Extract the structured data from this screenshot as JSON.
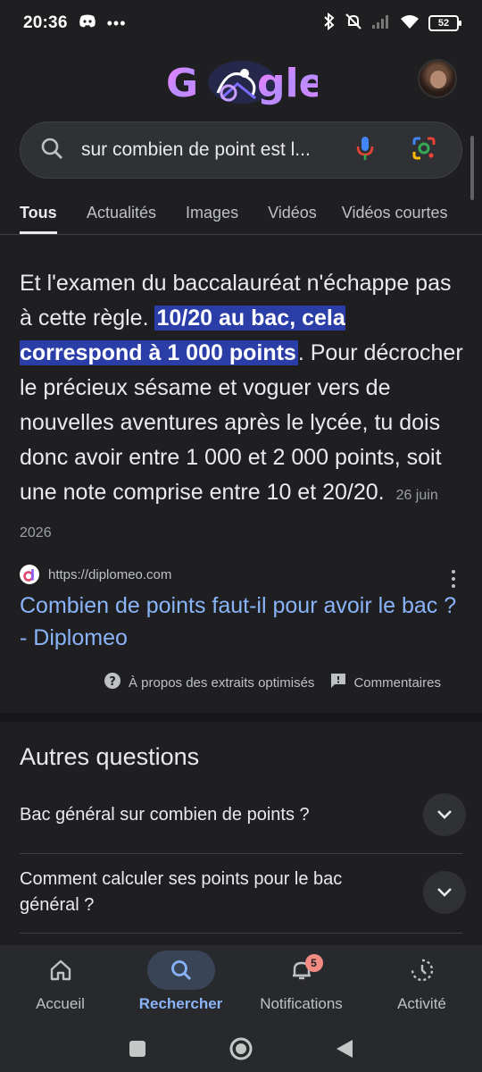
{
  "status_bar": {
    "time": "20:36",
    "battery": "52"
  },
  "header": {
    "logo_text": "Google"
  },
  "search": {
    "query": "sur combien de point est l..."
  },
  "tabs": [
    {
      "label": "Tous",
      "active": true
    },
    {
      "label": "Actualités"
    },
    {
      "label": "Images"
    },
    {
      "label": "Vidéos"
    },
    {
      "label": "Vidéos courtes"
    }
  ],
  "snippet": {
    "text_before": "Et l'examen du baccalauréat n'échappe pas à cette règle. ",
    "highlight": "10/20 au bac, cela correspond à 1 000 points",
    "text_after": ". Pour décrocher le précieux sésame et voguer vers de nouvelles aventures après le lycée, tu dois donc avoir entre 1 000 et 2 000 points, soit une note comprise entre 10 et 20/20.",
    "date": "26 juin 2026"
  },
  "result": {
    "url": "https://diplomeo.com",
    "title": "Combien de points faut-il pour avoir le bac ? - Diplomeo",
    "about_label": "À propos des extraits optimisés",
    "feedback_label": "Commentaires"
  },
  "questions": {
    "title": "Autres questions",
    "items": [
      "Bac général sur combien de points ?",
      "Comment calculer ses points pour le bac général ?"
    ]
  },
  "bottom_nav": {
    "items": [
      "Accueil",
      "Rechercher",
      "Notifications",
      "Activité"
    ],
    "notification_count": "5"
  },
  "colors": {
    "background": "#1f1f22",
    "link": "#8ab4f8",
    "highlight": "#2b3ea8"
  }
}
